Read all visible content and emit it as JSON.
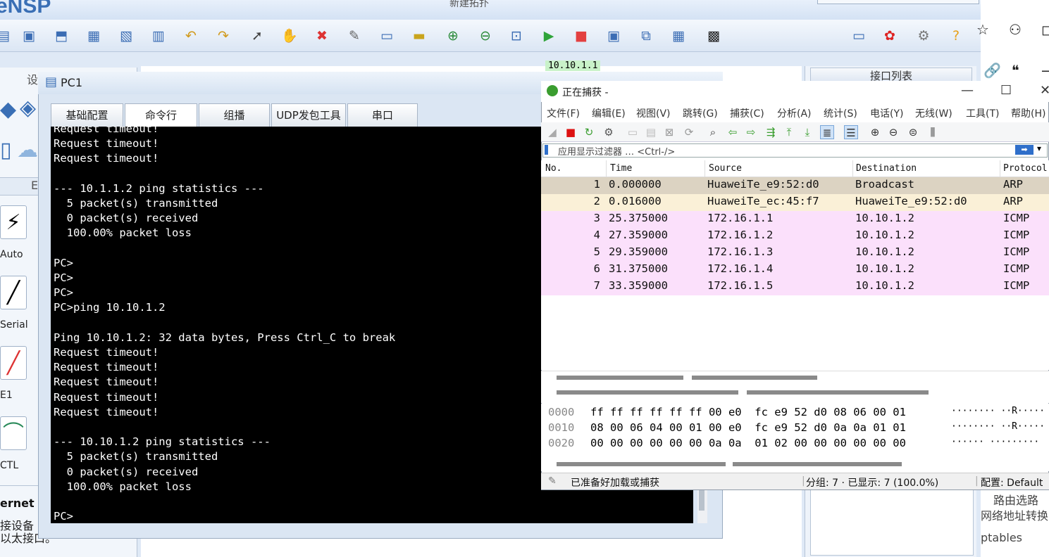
{
  "ensp": {
    "logo": "eNSP",
    "topology_title": "新建拓扑",
    "topo_ip_label": "10.10.1.1",
    "interface_panel_title": "接口列表",
    "left_panel_heading": "设",
    "left_panel_sub": "E",
    "devices": [
      "Auto",
      "Serial",
      "E1",
      "CTL"
    ],
    "left_bottom_title": "ernet",
    "left_bottom_line1": "接设备",
    "left_bottom_line2": "以太接口。"
  },
  "browser_side": {
    "text1": "路由选路",
    "text2": "网络地址转换",
    "text3": "ptables"
  },
  "pc1": {
    "title": "PC1",
    "tabs": [
      "基础配置",
      "命令行",
      "组播",
      "UDP发包工具",
      "串口"
    ],
    "active_tab": 1,
    "terminal_lines": [
      "Request timeout!",
      "Request timeout!",
      "Request timeout!",
      "",
      "--- 10.1.1.2 ping statistics ---",
      "  5 packet(s) transmitted",
      "  0 packet(s) received",
      "  100.00% packet loss",
      "",
      "PC>",
      "PC>",
      "PC>",
      "PC>ping 10.10.1.2",
      "",
      "Ping 10.10.1.2: 32 data bytes, Press Ctrl_C to break",
      "Request timeout!",
      "Request timeout!",
      "Request timeout!",
      "Request timeout!",
      "Request timeout!",
      "",
      "--- 10.10.1.2 ping statistics ---",
      "  5 packet(s) transmitted",
      "  0 packet(s) received",
      "  100.00% packet loss",
      "",
      "PC>"
    ]
  },
  "wireshark": {
    "title": "正在捕获 -",
    "menu": [
      "文件(F)",
      "编辑(E)",
      "视图(V)",
      "跳转(G)",
      "捕获(C)",
      "分析(A)",
      "统计(S)",
      "电话(Y)",
      "无线(W)",
      "工具(T)",
      "帮助(H)"
    ],
    "filter_placeholder": "应用显示过滤器 … <Ctrl-/>",
    "columns": [
      "No.",
      "Time",
      "Source",
      "Destination",
      "Protocol"
    ],
    "packets": [
      {
        "no": "1",
        "time": "0.000000",
        "src": "HuaweiTe_e9:52:d0",
        "dst": "Broadcast",
        "proto": "ARP",
        "color": "#dcd3c2"
      },
      {
        "no": "2",
        "time": "0.016000",
        "src": "HuaweiTe_ec:45:f7",
        "dst": "HuaweiTe_e9:52:d0",
        "proto": "ARP",
        "color": "#faf0d7"
      },
      {
        "no": "3",
        "time": "25.375000",
        "src": "172.16.1.1",
        "dst": "10.10.1.2",
        "proto": "ICMP",
        "color": "#fbe0fb"
      },
      {
        "no": "4",
        "time": "27.359000",
        "src": "172.16.1.2",
        "dst": "10.10.1.2",
        "proto": "ICMP",
        "color": "#fbe0fb"
      },
      {
        "no": "5",
        "time": "29.359000",
        "src": "172.16.1.3",
        "dst": "10.10.1.2",
        "proto": "ICMP",
        "color": "#fbe0fb"
      },
      {
        "no": "6",
        "time": "31.375000",
        "src": "172.16.1.4",
        "dst": "10.10.1.2",
        "proto": "ICMP",
        "color": "#fbe0fb"
      },
      {
        "no": "7",
        "time": "33.359000",
        "src": "172.16.1.5",
        "dst": "10.10.1.2",
        "proto": "ICMP",
        "color": "#fbe0fb"
      }
    ],
    "hex_rows": [
      {
        "offset": "0000",
        "bytes": "ff ff ff ff ff ff 00 e0  fc e9 52 d0 08 06 00 01",
        "ascii": "········ ··R·····"
      },
      {
        "offset": "0010",
        "bytes": "08 00 06 04 00 01 00 e0  fc e9 52 d0 0a 0a 01 01",
        "ascii": "········ ··R·····"
      },
      {
        "offset": "0020",
        "bytes": "00 00 00 00 00 00 0a 0a  01 02 00 00 00 00 00 00",
        "ascii": "······ ·········"
      }
    ],
    "status_ready": "已准备好加载或捕获",
    "status_packets": "分组: 7 · 已显示: 7 (100.0%)",
    "status_profile": "配置: Default"
  }
}
